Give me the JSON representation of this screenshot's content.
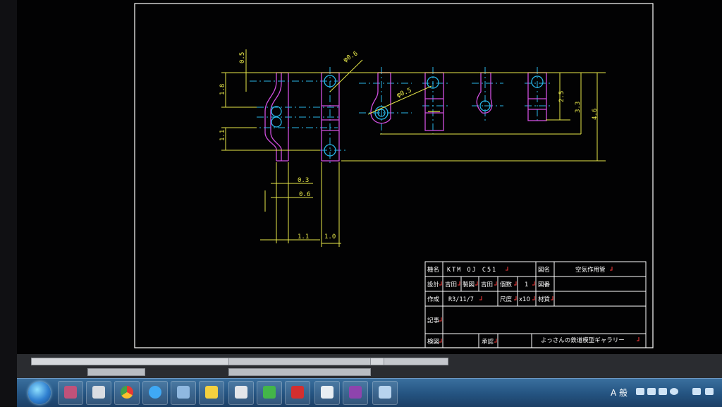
{
  "drawing": {
    "dimensions": {
      "d_0_5_top": "0.5",
      "d_1_8": "1.8",
      "d_1_1_left": "1.1",
      "d_0_3": "0.3",
      "d_0_6": "0.6",
      "d_1_1_bottom": "1.1",
      "d_1_0": "1.0",
      "d_phi_0_6": "φ0.6",
      "d_phi_0_5": "φ0.5",
      "d_2_5": "2.5",
      "d_3_3": "3.3",
      "d_4_6": "4.6"
    },
    "title_block": {
      "model_label": "機名",
      "model_value": "KTM OJ C51",
      "drawing_name_label": "図名",
      "drawing_name_value": "空気作用管",
      "design_label": "設計",
      "design_value": "吉田",
      "drafting_label": "製図",
      "drafting_value": "吉田",
      "quantity_label": "個数",
      "quantity_value": "1",
      "drawing_no_label": "図番",
      "created_label": "作成",
      "created_value": "R3/11/7",
      "scale_label": "尺度",
      "scale_value": "x10",
      "material_label": "材質",
      "notes_label": "記事",
      "checked_label": "検図",
      "approved_label": "承認",
      "gallery": "よっさんの鉄道模型ギャラリー"
    }
  },
  "colors": {
    "dimension": "#e8e84a",
    "outline": "#d14fe0",
    "center": "#29b6e8",
    "border": "#ffffff",
    "red_mark": "#ff3a3a"
  },
  "taskbar": {
    "ime": "A 般"
  }
}
